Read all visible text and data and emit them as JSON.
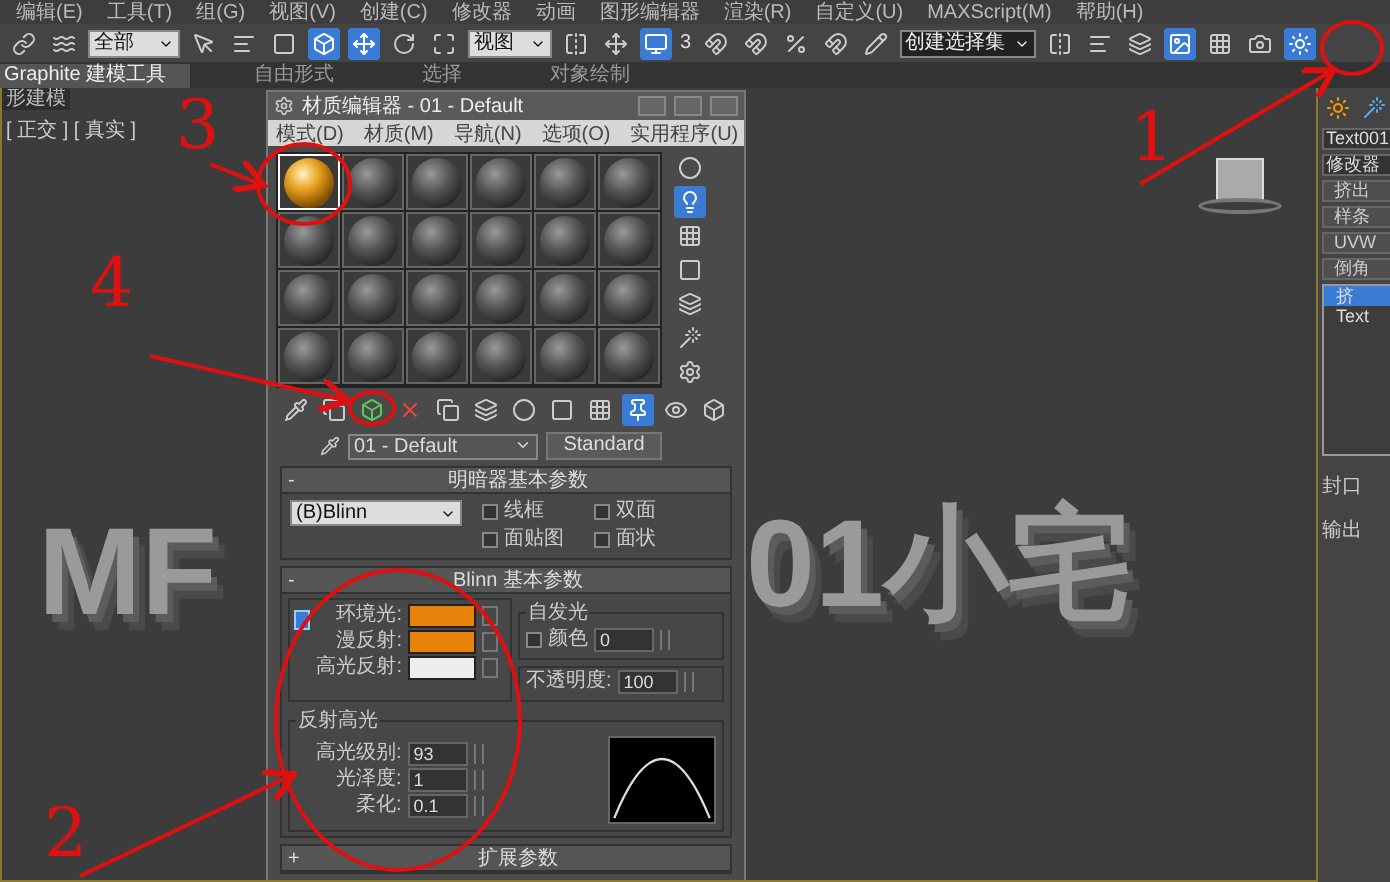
{
  "menu_bar": [
    "编辑(E)",
    "工具(T)",
    "组(G)",
    "视图(V)",
    "创建(C)",
    "修改器",
    "动画",
    "图形编辑器",
    "渲染(R)",
    "自定义(U)",
    "MAXScript(M)",
    "帮助(H)"
  ],
  "toolbar": {
    "selection_filter": "全部",
    "reference_coord": "视图",
    "snap_label": "3",
    "named_selection": "创建选择集"
  },
  "ribbon_tabs": [
    {
      "label": "Graphite 建模工具",
      "selected": true
    },
    {
      "label": "自由形式",
      "selected": false
    },
    {
      "label": "选择",
      "selected": false
    },
    {
      "label": "对象绘制",
      "selected": false
    }
  ],
  "ribbon_panel_label": "形建模",
  "viewport": {
    "label": "[ 正交 ] [ 真实 ]",
    "scene_text": [
      "MF",
      "01小宅"
    ]
  },
  "material_editor": {
    "title": "材质编辑器 - 01 - Default",
    "menu": [
      "模式(D)",
      "材质(M)",
      "导航(N)",
      "选项(O)",
      "实用程序(U)"
    ],
    "slots": [
      {
        "kind": "gold",
        "selected": true
      },
      {
        "kind": "plain",
        "selected": false
      },
      {
        "kind": "plain",
        "selected": false
      },
      {
        "kind": "plain",
        "selected": false
      },
      {
        "kind": "plain",
        "selected": false
      },
      {
        "kind": "plain",
        "selected": false
      },
      {
        "kind": "plain",
        "selected": false
      },
      {
        "kind": "plain",
        "selected": false
      },
      {
        "kind": "plain",
        "selected": false
      },
      {
        "kind": "plain",
        "selected": false
      },
      {
        "kind": "plain",
        "selected": false
      },
      {
        "kind": "plain",
        "selected": false
      },
      {
        "kind": "plain",
        "selected": false
      },
      {
        "kind": "plain",
        "selected": false
      },
      {
        "kind": "plain",
        "selected": false
      },
      {
        "kind": "plain",
        "selected": false
      },
      {
        "kind": "plain",
        "selected": false
      },
      {
        "kind": "plain",
        "selected": false
      },
      {
        "kind": "plain",
        "selected": false
      },
      {
        "kind": "plain",
        "selected": false
      },
      {
        "kind": "plain",
        "selected": false
      },
      {
        "kind": "plain",
        "selected": false
      },
      {
        "kind": "plain",
        "selected": false
      },
      {
        "kind": "plain",
        "selected": false
      }
    ],
    "material_name": "01 - Default",
    "material_type": "Standard",
    "shader_rollout": {
      "toggle": "-",
      "title": "明暗器基本参数",
      "shader": "(B)Blinn",
      "options": [
        {
          "label": "线框",
          "checked": false
        },
        {
          "label": "双面",
          "checked": false
        },
        {
          "label": "面贴图",
          "checked": false
        },
        {
          "label": "面状",
          "checked": false
        }
      ]
    },
    "blinn_rollout": {
      "toggle": "-",
      "title": "Blinn 基本参数",
      "colors": [
        {
          "label": "环境光:",
          "color": "#e8820a"
        },
        {
          "label": "漫反射:",
          "color": "#e8820a"
        },
        {
          "label": "高光反射:",
          "color": "#eeeeee"
        }
      ],
      "self_illumination": {
        "title": "自发光",
        "label": "颜色",
        "checked": false,
        "value": "0"
      },
      "opacity": {
        "label": "不透明度:",
        "value": "100"
      },
      "highlights": {
        "title": "反射高光",
        "fields": [
          {
            "label": "高光级别:",
            "value": "93"
          },
          {
            "label": "光泽度:",
            "value": "1"
          },
          {
            "label": "柔化:",
            "value": "0.1"
          }
        ]
      }
    },
    "extended_rollout": {
      "toggle": "+",
      "title": "扩展参数"
    }
  },
  "command_panel": {
    "object_name": "Text001",
    "modifier_list": "修改器",
    "modifier_buttons": [
      "挤出",
      "样条",
      "UVW",
      "倒角"
    ],
    "stack": [
      {
        "label": "挤",
        "selected": true
      },
      {
        "label": "Text",
        "selected": false
      }
    ],
    "groups": [
      "封口",
      "输出"
    ]
  },
  "annotations": [
    "1",
    "2",
    "3",
    "4"
  ]
}
